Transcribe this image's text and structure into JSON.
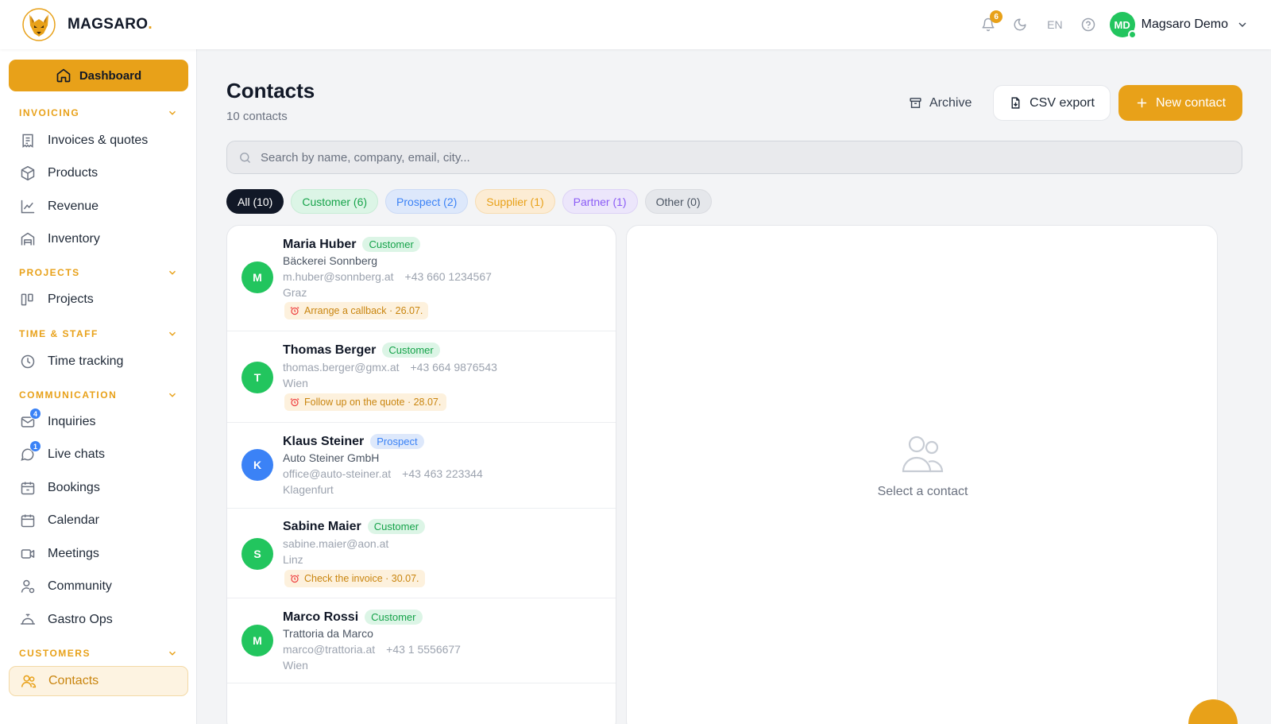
{
  "brand": {
    "name": "MAGSARO",
    "dot": "."
  },
  "topbar": {
    "notification_count": "6",
    "language": "EN",
    "user_initials": "MD",
    "user_name": "Magsaro Demo"
  },
  "sidebar": {
    "dashboard": "Dashboard",
    "sections": {
      "invoicing": "INVOICING",
      "projects": "PROJECTS",
      "time_staff": "TIME & STAFF",
      "communication": "COMMUNICATION",
      "customers": "CUSTOMERS"
    },
    "items": {
      "invoices": "Invoices & quotes",
      "products": "Products",
      "revenue": "Revenue",
      "inventory": "Inventory",
      "projects": "Projects",
      "time_tracking": "Time tracking",
      "inquiries": "Inquiries",
      "inquiries_badge": "4",
      "live_chats": "Live chats",
      "live_chats_badge": "1",
      "bookings": "Bookings",
      "calendar": "Calendar",
      "meetings": "Meetings",
      "community": "Community",
      "gastro_ops": "Gastro Ops",
      "contacts": "Contacts"
    }
  },
  "main": {
    "title": "Contacts",
    "subtitle": "10 contacts",
    "archive_label": "Archive",
    "csv_label": "CSV export",
    "new_label": "New contact",
    "search_placeholder": "Search by name, company, email, city...",
    "filters": {
      "all": "All (10)",
      "customer": "Customer (6)",
      "prospect": "Prospect (2)",
      "supplier": "Supplier (1)",
      "partner": "Partner (1)",
      "other": "Other (0)"
    },
    "empty_text": "Select a contact"
  },
  "contacts": [
    {
      "initial": "M",
      "name": "Maria Huber",
      "type": "Customer",
      "company": "Bäckerei Sonnberg",
      "email": "m.huber@sonnberg.at",
      "phone": "+43 660 1234567",
      "city": "Graz",
      "reminder": "Arrange a callback · 26.07."
    },
    {
      "initial": "T",
      "name": "Thomas Berger",
      "type": "Customer",
      "email": "thomas.berger@gmx.at",
      "phone": "+43 664 9876543",
      "city": "Wien",
      "reminder": "Follow up on the quote · 28.07."
    },
    {
      "initial": "K",
      "name": "Klaus Steiner",
      "type": "Prospect",
      "company": "Auto Steiner GmbH",
      "email": "office@auto-steiner.at",
      "phone": "+43 463 223344",
      "city": "Klagenfurt"
    },
    {
      "initial": "S",
      "name": "Sabine Maier",
      "type": "Customer",
      "email": "sabine.maier@aon.at",
      "city": "Linz",
      "reminder": "Check the invoice · 30.07."
    },
    {
      "initial": "M",
      "name": "Marco Rossi",
      "type": "Customer",
      "company": "Trattoria da Marco",
      "email": "marco@trattoria.at",
      "phone": "+43 1 5556677",
      "city": "Wien"
    }
  ],
  "colors": {
    "accent": "#e8a119",
    "green": "#22c55e",
    "blue": "#3b82f6",
    "purple": "#8b5cf6"
  }
}
